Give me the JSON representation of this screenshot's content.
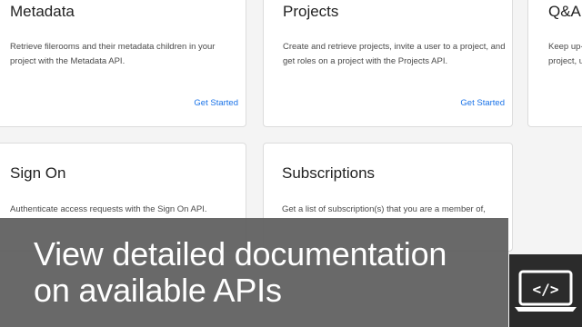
{
  "cards": [
    {
      "title": "Metadata",
      "description": "Retrieve filerooms and their metadata children in your project with the Metadata API.",
      "link": "Get Started"
    },
    {
      "title": "Projects",
      "description": "Create and retrieve projects, invite a user to a project, and get roles on a project with the Projects API.",
      "link": "Get Started"
    },
    {
      "title": "Q&A",
      "description_line1": "Keep up-",
      "description_line2": "project, u"
    },
    {
      "title": "Sign On",
      "description": "Authenticate access requests with the Sign On API."
    },
    {
      "title": "Subscriptions",
      "description": "Get a list of  subscription(s) that you are a member of,"
    }
  ],
  "overlay": {
    "line1": "View detailed documentation",
    "line2": "on available APIs"
  },
  "badge": {
    "icon": "laptop-code-icon",
    "glyph": "</>"
  },
  "colors": {
    "link": "#1a73e8",
    "overlay": "#5c5c5c",
    "badge": "#2b2b2b"
  }
}
